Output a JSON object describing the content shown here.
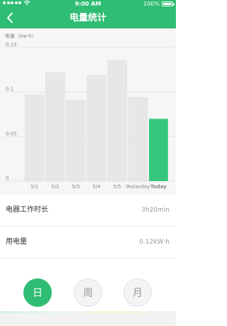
{
  "status_bar": {
    "time": "9:00 AM",
    "battery": "100%"
  },
  "nav": {
    "title": "电量统计",
    "back_icon": "chevron-left-icon"
  },
  "colors": {
    "brand": "#2ebd72",
    "bar": "#e7e7e7",
    "bar_highlight": "#34c77b"
  },
  "chart": {
    "unit_label": "电量（kw·h）",
    "y_tick_labels": [
      "0.15",
      "0.1",
      "0.05",
      "0"
    ]
  },
  "chart_data": {
    "type": "bar",
    "categories": [
      "5/1",
      "5/2",
      "5/3",
      "5/4",
      "5/5",
      "Yesterday",
      "Today"
    ],
    "values": [
      0.097,
      0.122,
      0.091,
      0.119,
      0.136,
      0.094,
      0.07
    ],
    "highlight_index": 6,
    "ylabel": "电量（kw·h）",
    "ylim": [
      0,
      0.15
    ],
    "yticks": [
      0,
      0.05,
      0.1,
      0.15
    ],
    "grid": true
  },
  "stats": {
    "runtime": {
      "label": "电器工作时长",
      "value": "3h20min"
    },
    "usage": {
      "label": "用电量",
      "value": "0.12kW·h"
    }
  },
  "period": {
    "day": "日",
    "week": "周",
    "month": "月"
  }
}
